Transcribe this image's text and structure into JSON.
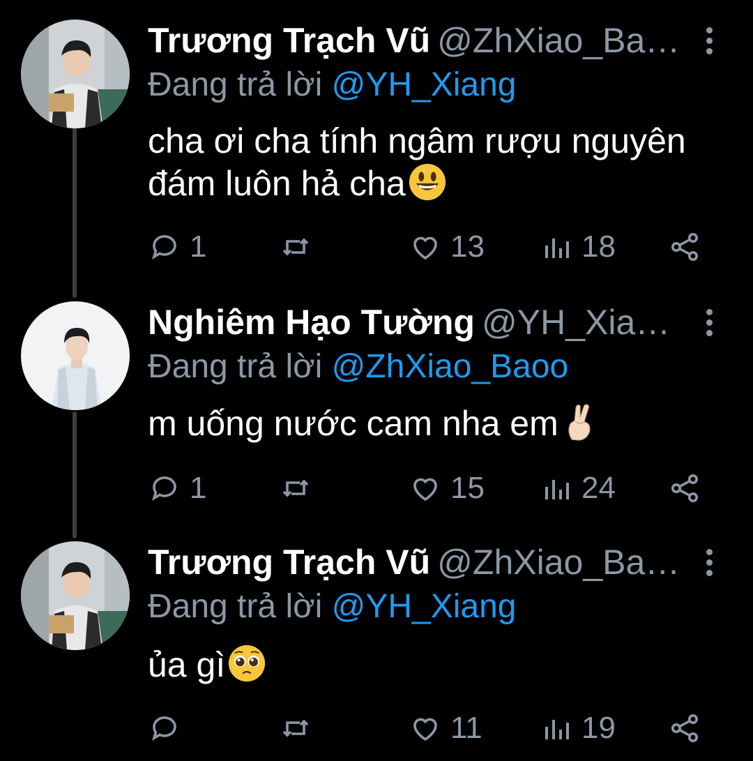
{
  "thread": [
    {
      "name": "Trương Trạch Vũ",
      "handle": "@ZhXiao_Ba…",
      "replying_label": "Đang trả lời",
      "replying_to": "@YH_Xiang",
      "text_lines": [
        "cha ơi cha tính ngâm rượu nguyên",
        "đám luôn hả cha"
      ],
      "emoji": "smiley-emoji",
      "stats": {
        "replies": "1",
        "retweets": "",
        "likes": "13",
        "views": "18"
      }
    },
    {
      "name": "Nghiêm Hạo Tường",
      "handle": "@YH_Xia…",
      "replying_label": "Đang trả lời",
      "replying_to": "@ZhXiao_Baoo",
      "text_lines": [
        "m uống nước cam nha em"
      ],
      "emoji": "crossed-fingers-emoji",
      "stats": {
        "replies": "1",
        "retweets": "",
        "likes": "15",
        "views": "24"
      }
    },
    {
      "name": "Trương Trạch Vũ",
      "handle": "@ZhXiao_Ba…",
      "replying_label": "Đang trả lời",
      "replying_to": "@YH_Xiang",
      "text_lines": [
        "ủa gì"
      ],
      "emoji": "pleading-face-emoji",
      "stats": {
        "replies": "",
        "retweets": "",
        "likes": "11",
        "views": "19"
      }
    }
  ],
  "colors": {
    "background": "#000000",
    "muted": "#8b98a5",
    "mention": "#1d9bf0",
    "thread_line": "#3a3f44"
  }
}
